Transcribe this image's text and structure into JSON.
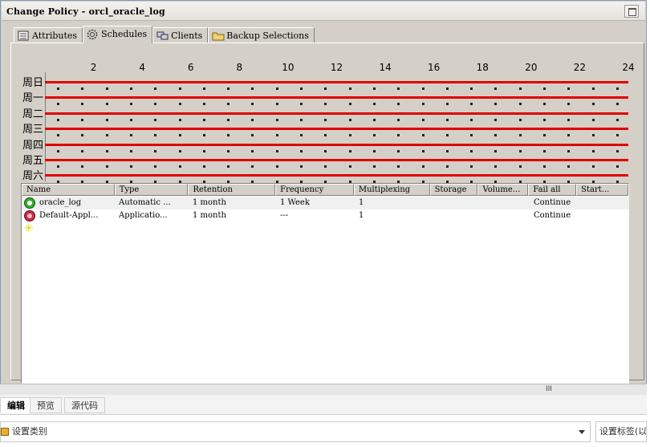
{
  "window": {
    "title": "Change Policy - orcl_oracle_log"
  },
  "tabs": [
    {
      "label": "Attributes",
      "icon": "list-icon"
    },
    {
      "label": "Schedules",
      "icon": "gear-icon"
    },
    {
      "label": "Clients",
      "icon": "computers-icon"
    },
    {
      "label": "Backup Selections",
      "icon": "folder-icon"
    }
  ],
  "schedule_grid": {
    "hours": [
      "2",
      "4",
      "6",
      "8",
      "10",
      "12",
      "14",
      "16",
      "18",
      "20",
      "22",
      "24"
    ],
    "days": [
      "周日",
      "周一",
      "周二",
      "周三",
      "周四",
      "周五",
      "周六"
    ]
  },
  "table": {
    "columns": [
      "Name",
      "Type",
      "Retention",
      "Frequency",
      "Multiplexing",
      "Storage",
      "Volume...",
      "Fail all",
      "Start..."
    ],
    "rows": [
      {
        "name": "oracle_log",
        "type": "Automatic ...",
        "retention": "1 month",
        "frequency": "1 Week",
        "multiplexing": "1",
        "storage": "",
        "volume": "",
        "fail_all": "Continue",
        "start": "",
        "icon": "clock-green-icon"
      },
      {
        "name": "Default-Appl...",
        "type": "Applicatio...",
        "retention": "1 month",
        "frequency": "---",
        "multiplexing": "1",
        "storage": "",
        "volume": "",
        "fail_all": "Continue",
        "start": "",
        "icon": "clock-red-icon"
      }
    ],
    "new_row_icon": "new-schedule-star-icon"
  },
  "editor_modes": {
    "edit": "编辑",
    "preview": "预览",
    "source": "源代码"
  },
  "property_bar": {
    "category_placeholder": "设置类别",
    "tag_placeholder": "设置标签(以"
  },
  "colors": {
    "window_bg": "#d4d0c8",
    "schedule_line": "#e00000"
  }
}
